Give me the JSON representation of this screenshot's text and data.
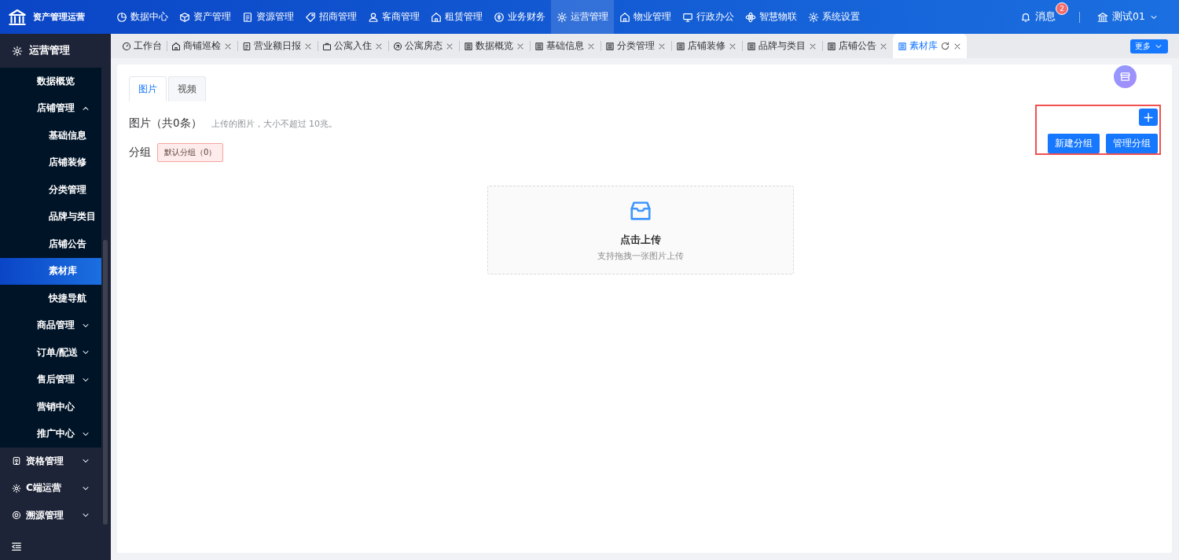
{
  "app": {
    "title": "资产管理运营"
  },
  "nav": [
    {
      "label": "数据中心",
      "selected": false
    },
    {
      "label": "资产管理",
      "selected": false
    },
    {
      "label": "资源管理",
      "selected": false
    },
    {
      "label": "招商管理",
      "selected": false
    },
    {
      "label": "客商管理",
      "selected": false
    },
    {
      "label": "租赁管理",
      "selected": false
    },
    {
      "label": "业务财务",
      "selected": false
    },
    {
      "label": "运营管理",
      "selected": true
    },
    {
      "label": "物业管理",
      "selected": false
    },
    {
      "label": "行政办公",
      "selected": false
    },
    {
      "label": "智慧物联",
      "selected": false
    },
    {
      "label": "系统设置",
      "selected": false
    }
  ],
  "notifications": {
    "label": "消息",
    "badge": "2"
  },
  "user": {
    "name": "测试01"
  },
  "sidebar": {
    "section": {
      "label": "运营管理"
    },
    "items": [
      {
        "label": "数据概览",
        "selected": false
      },
      {
        "label": "店铺管理",
        "selected": false,
        "expanded": true,
        "children": [
          {
            "label": "基础信息",
            "selected": false
          },
          {
            "label": "店铺装修",
            "selected": false
          },
          {
            "label": "分类管理",
            "selected": false
          },
          {
            "label": "品牌与类目",
            "selected": false
          },
          {
            "label": "店铺公告",
            "selected": false
          },
          {
            "label": "素材库",
            "selected": true
          },
          {
            "label": "快捷导航",
            "selected": false
          }
        ]
      },
      {
        "label": "商品管理",
        "selected": false,
        "expanded": false
      },
      {
        "label": "订单/配送",
        "selected": false,
        "expanded": false
      },
      {
        "label": "售后管理",
        "selected": false,
        "expanded": false
      },
      {
        "label": "营销中心",
        "selected": false
      },
      {
        "label": "推广中心",
        "selected": false,
        "expanded": false
      }
    ],
    "groups": [
      {
        "label": "资格管理",
        "expanded": false
      },
      {
        "label": "C端运营",
        "expanded": false
      },
      {
        "label": "溯源管理",
        "expanded": false
      }
    ]
  },
  "page_tabs": [
    {
      "label": "工作台",
      "selected": false,
      "closable": false
    },
    {
      "label": "商铺巡检",
      "selected": false,
      "closable": true
    },
    {
      "label": "营业额日报",
      "selected": false,
      "closable": true
    },
    {
      "label": "公寓入住",
      "selected": false,
      "closable": true
    },
    {
      "label": "公寓房态",
      "selected": false,
      "closable": true
    },
    {
      "label": "数据概览",
      "selected": false,
      "closable": true
    },
    {
      "label": "基础信息",
      "selected": false,
      "closable": true
    },
    {
      "label": "分类管理",
      "selected": false,
      "closable": true
    },
    {
      "label": "店铺装修",
      "selected": false,
      "closable": true
    },
    {
      "label": "品牌与类目",
      "selected": false,
      "closable": true
    },
    {
      "label": "店铺公告",
      "selected": false,
      "closable": true
    },
    {
      "label": "素材库",
      "selected": true,
      "closable": true
    }
  ],
  "more_button": "更多",
  "content": {
    "tabs": [
      {
        "label": "图片",
        "selected": true
      },
      {
        "label": "视频",
        "selected": false
      }
    ],
    "title": "图片（共0条）",
    "hint": "上传的图片，大小不超过 10兆。",
    "group_label": "分组",
    "groups": [
      {
        "label": "默认分组（0）",
        "selected": true
      }
    ],
    "add_button": "+",
    "buttons": [
      "新建分组",
      "管理分组"
    ],
    "upload": {
      "title": "点击上传",
      "hint": "支持拖拽一张图片上传"
    }
  }
}
